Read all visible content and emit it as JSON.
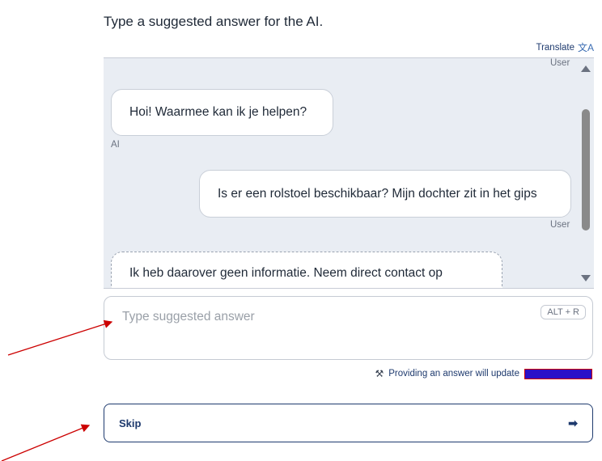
{
  "instruction": "Type a suggested answer for the AI.",
  "translate": {
    "label": "Translate",
    "icon": "translate-icon"
  },
  "chat": {
    "top_sender": "User",
    "messages": [
      {
        "text": "Hoi! Waarmee kan ik je helpen?",
        "sender": "AI"
      },
      {
        "text": "Is er een rolstoel beschikbaar? Mijn dochter zit in het gips",
        "sender": "User"
      },
      {
        "text": "Ik heb daarover geen informatie. Neem direct contact op",
        "sender": ""
      }
    ]
  },
  "answer": {
    "placeholder": "Type suggested answer",
    "value": "",
    "shortcut": "ALT + R"
  },
  "hint": {
    "text": "Providing an answer will update",
    "icon": "magic-wand-icon",
    "redacted_color": "#2a10c8"
  },
  "skip": {
    "label": "Skip",
    "icon": "arrow-right-icon"
  },
  "colors": {
    "accent": "#1e3a6e",
    "chat_bg": "#e9edf3",
    "annotation_arrow": "#cc0000"
  }
}
